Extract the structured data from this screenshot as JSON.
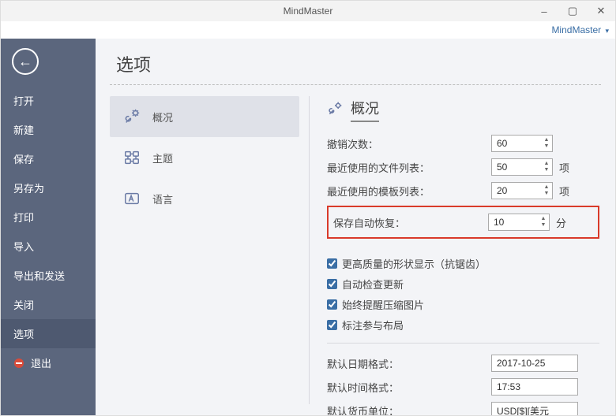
{
  "window": {
    "title": "MindMaster"
  },
  "appMenu": {
    "label": "MindMaster"
  },
  "sidebar": {
    "items": [
      "打开",
      "新建",
      "保存",
      "另存为",
      "打印",
      "导入",
      "导出和发送",
      "关闭",
      "选项"
    ],
    "exit": "退出",
    "activeIndex": 8
  },
  "page": {
    "title": "选项"
  },
  "optionNav": {
    "items": [
      {
        "label": "概况",
        "icon": "wrench-gear-icon"
      },
      {
        "label": "主题",
        "icon": "theme-icon"
      },
      {
        "label": "语言",
        "icon": "language-icon"
      }
    ],
    "activeIndex": 0
  },
  "general": {
    "sectionTitle": "概况",
    "rows": {
      "undo": {
        "label": "撤销次数：",
        "value": "60",
        "unit": ""
      },
      "recentFiles": {
        "label": "最近使用的文件列表：",
        "value": "50",
        "unit": "项"
      },
      "recentTemplates": {
        "label": "最近使用的模板列表：",
        "value": "20",
        "unit": "项"
      },
      "autoRecover": {
        "label": "保存自动恢复：",
        "value": "10",
        "unit": "分"
      }
    },
    "checkboxes": [
      {
        "label": "更高质量的形状显示（抗锯齿）",
        "checked": true
      },
      {
        "label": "自动检查更新",
        "checked": true
      },
      {
        "label": "始终提醒压缩图片",
        "checked": true
      },
      {
        "label": "标注参与布局",
        "checked": true
      }
    ],
    "defaults": {
      "dateFmt": {
        "label": "默认日期格式：",
        "value": "2017-10-25"
      },
      "timeFmt": {
        "label": "默认时间格式：",
        "value": "17:53"
      },
      "currency": {
        "label": "默认货币单位：",
        "value": "USD[$][美元"
      }
    }
  }
}
